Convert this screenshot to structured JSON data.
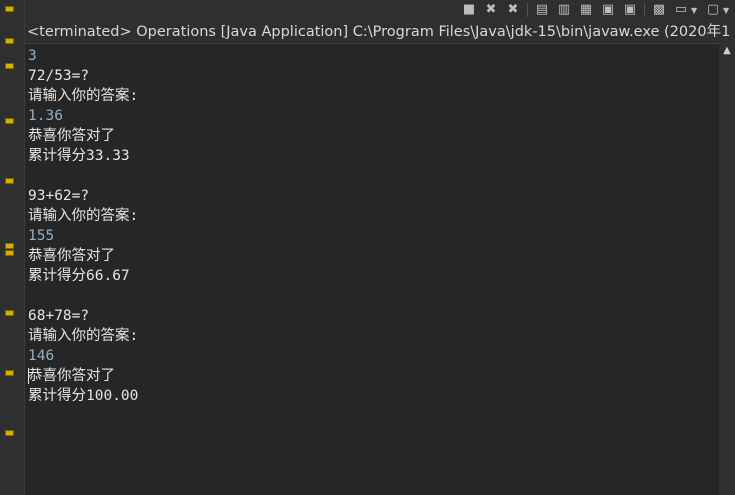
{
  "toolbar": {
    "icons": [
      {
        "name": "terminate-icon",
        "glyph": "■"
      },
      {
        "name": "remove-launch-icon",
        "glyph": "✖"
      },
      {
        "name": "remove-all-terminated-icon",
        "glyph": "✖"
      },
      {
        "name": "clear-console-icon",
        "glyph": "▤"
      },
      {
        "name": "scroll-lock-icon",
        "glyph": "▥"
      },
      {
        "name": "word-wrap-icon",
        "glyph": "▦"
      },
      {
        "name": "show-console-on-stdout-icon",
        "glyph": "▣"
      },
      {
        "name": "show-console-on-stderr-icon",
        "glyph": "▣"
      },
      {
        "name": "pin-console-icon",
        "glyph": "▩"
      },
      {
        "name": "display-selected-console-icon",
        "glyph": "▭"
      },
      {
        "name": "open-console-icon",
        "glyph": "▢"
      }
    ]
  },
  "console": {
    "title": "<terminated> Operations [Java Application] C:\\Program Files\\Java\\jdk-15\\bin\\javaw.exe  (2020年1"
  },
  "output": {
    "lines": [
      {
        "text": "3",
        "type": "input"
      },
      {
        "text": "72/53=?",
        "type": "output"
      },
      {
        "text": "请输入你的答案:",
        "type": "output"
      },
      {
        "text": "1.36",
        "type": "input"
      },
      {
        "text": "恭喜你答对了",
        "type": "output"
      },
      {
        "text": "累计得分33.33",
        "type": "output"
      },
      {
        "text": "",
        "type": "output"
      },
      {
        "text": "93+62=?",
        "type": "output"
      },
      {
        "text": "请输入你的答案:",
        "type": "output"
      },
      {
        "text": "155",
        "type": "input"
      },
      {
        "text": "恭喜你答对了",
        "type": "output"
      },
      {
        "text": "累计得分66.67",
        "type": "output"
      },
      {
        "text": "",
        "type": "output"
      },
      {
        "text": "68+78=?",
        "type": "output"
      },
      {
        "text": "请输入你的答案:",
        "type": "output"
      },
      {
        "text": "146",
        "type": "input"
      },
      {
        "text": "恭喜你答对了",
        "type": "output"
      },
      {
        "text": "累计得分100.00",
        "type": "output"
      }
    ]
  },
  "colors": {
    "background": "#262626",
    "output_text": "#e6e6e6",
    "input_text": "#8fb2cc",
    "marker": "#d6b000"
  }
}
